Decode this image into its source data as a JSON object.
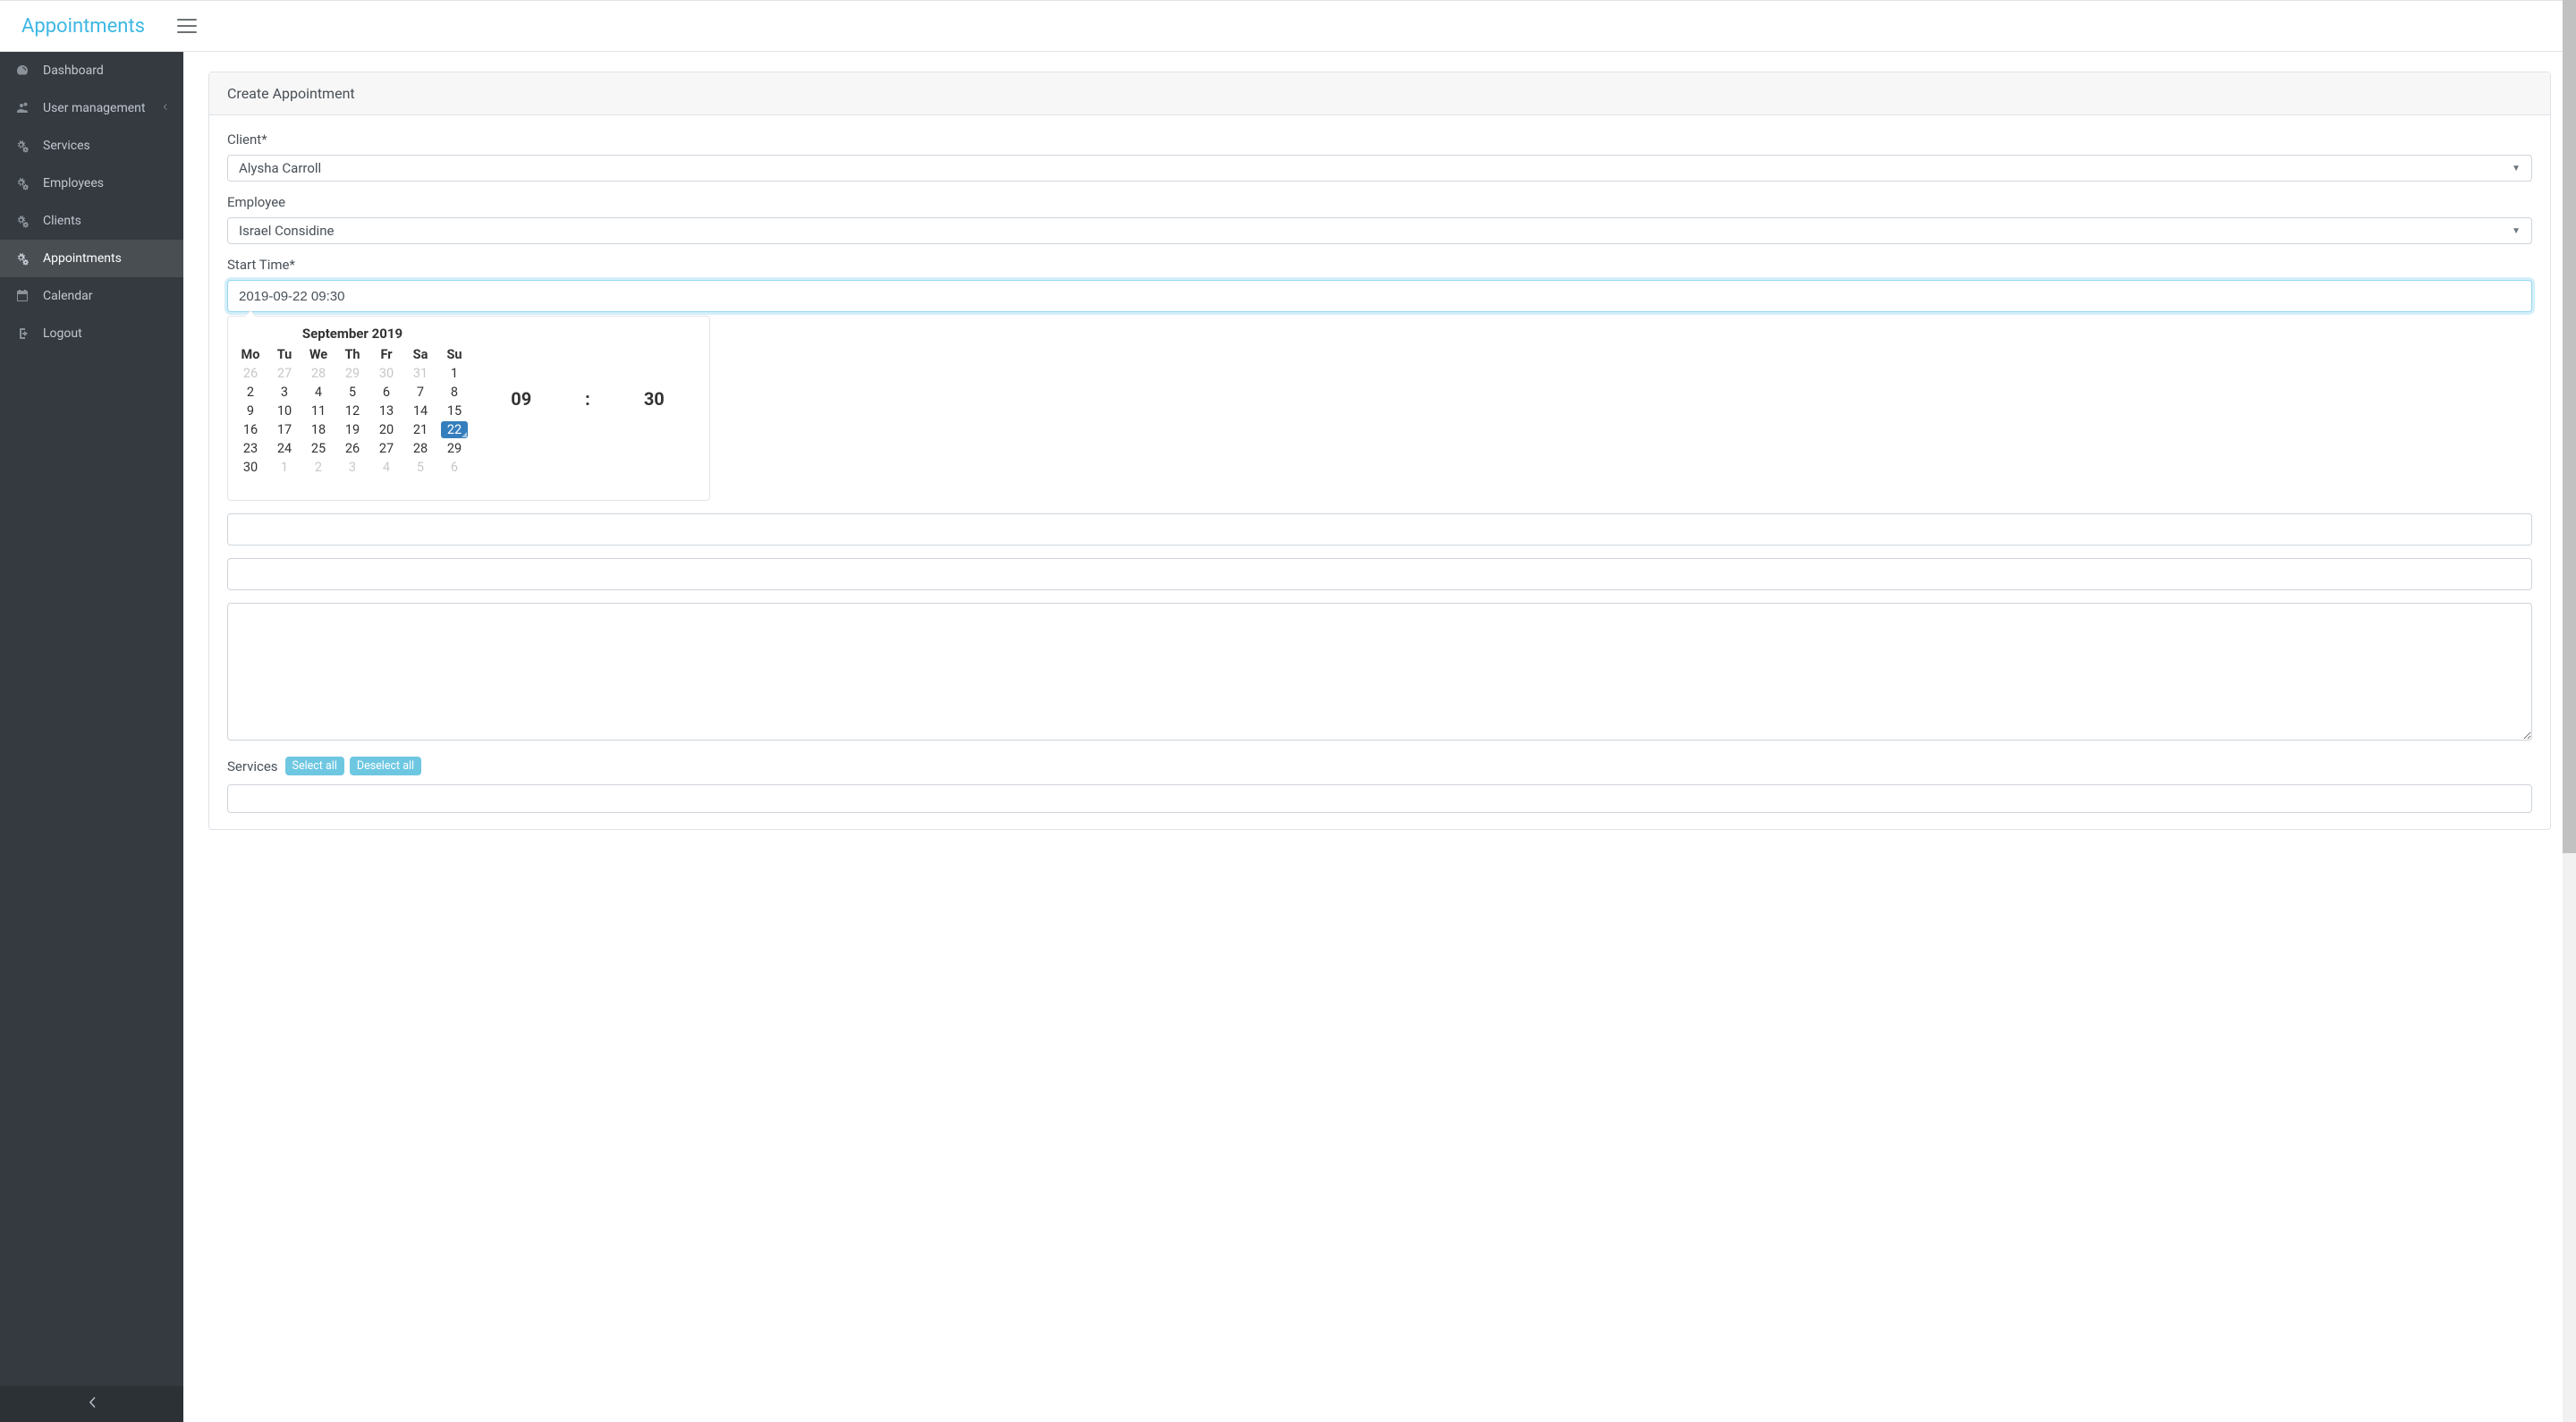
{
  "brand": "Appointments",
  "sidebar": {
    "items": [
      {
        "label": "Dashboard",
        "icon": "dashboard"
      },
      {
        "label": "User management",
        "icon": "users",
        "expandable": true
      },
      {
        "label": "Services",
        "icon": "cogs"
      },
      {
        "label": "Employees",
        "icon": "cogs"
      },
      {
        "label": "Clients",
        "icon": "cogs"
      },
      {
        "label": "Appointments",
        "icon": "cogs",
        "active": true
      },
      {
        "label": "Calendar",
        "icon": "calendar"
      },
      {
        "label": "Logout",
        "icon": "logout"
      }
    ]
  },
  "card": {
    "header": "Create Appointment"
  },
  "form": {
    "client_label": "Client*",
    "client_value": "Alysha Carroll",
    "employee_label": "Employee",
    "employee_value": "Israel Considine",
    "start_time_label": "Start Time*",
    "start_time_value": "2019-09-22 09:30",
    "services_label": "Services",
    "select_all": "Select all",
    "deselect_all": "Deselect all"
  },
  "calendar": {
    "title": "September 2019",
    "dow": [
      "Mo",
      "Tu",
      "We",
      "Th",
      "Fr",
      "Sa",
      "Su"
    ],
    "weeks": [
      [
        {
          "d": "26",
          "out": true
        },
        {
          "d": "27",
          "out": true
        },
        {
          "d": "28",
          "out": true
        },
        {
          "d": "29",
          "out": true
        },
        {
          "d": "30",
          "out": true
        },
        {
          "d": "31",
          "out": true
        },
        {
          "d": "1"
        }
      ],
      [
        {
          "d": "2"
        },
        {
          "d": "3"
        },
        {
          "d": "4"
        },
        {
          "d": "5"
        },
        {
          "d": "6"
        },
        {
          "d": "7"
        },
        {
          "d": "8"
        }
      ],
      [
        {
          "d": "9"
        },
        {
          "d": "10"
        },
        {
          "d": "11"
        },
        {
          "d": "12"
        },
        {
          "d": "13"
        },
        {
          "d": "14"
        },
        {
          "d": "15"
        }
      ],
      [
        {
          "d": "16"
        },
        {
          "d": "17"
        },
        {
          "d": "18"
        },
        {
          "d": "19"
        },
        {
          "d": "20"
        },
        {
          "d": "21"
        },
        {
          "d": "22",
          "selected": true
        }
      ],
      [
        {
          "d": "23"
        },
        {
          "d": "24"
        },
        {
          "d": "25"
        },
        {
          "d": "26"
        },
        {
          "d": "27"
        },
        {
          "d": "28"
        },
        {
          "d": "29"
        }
      ],
      [
        {
          "d": "30"
        },
        {
          "d": "1",
          "out": true
        },
        {
          "d": "2",
          "out": true
        },
        {
          "d": "3",
          "out": true
        },
        {
          "d": "4",
          "out": true
        },
        {
          "d": "5",
          "out": true
        },
        {
          "d": "6",
          "out": true
        }
      ]
    ],
    "hour": "09",
    "minute": "30",
    "sep": ":"
  }
}
